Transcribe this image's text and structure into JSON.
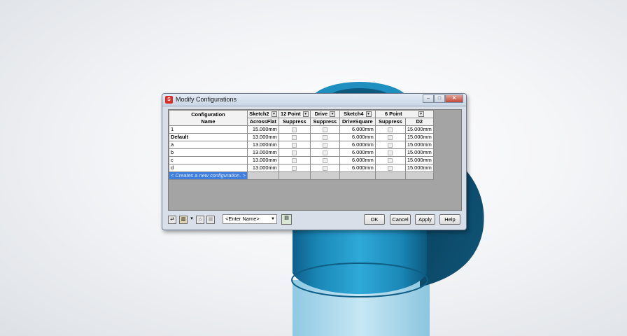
{
  "window": {
    "title": "Modify Configurations"
  },
  "table": {
    "name_header": [
      "Configuration",
      "Name"
    ],
    "feature_groups": [
      "Sketch2",
      "12 Point",
      "Drive",
      "Sketch4",
      "6 Point"
    ],
    "param_headers": [
      "AcrossFlat",
      "Suppress",
      "Suppress",
      "DriveSquare",
      "Suppress",
      "D2"
    ],
    "rows": [
      {
        "name": "1",
        "across": "15.000mm",
        "drive_sq": "6.000mm",
        "d2": "15.000mm"
      },
      {
        "name": "Default",
        "across": "13.000mm",
        "drive_sq": "6.000mm",
        "d2": "15.000mm"
      },
      {
        "name": "a",
        "across": "13.000mm",
        "drive_sq": "6.000mm",
        "d2": "15.000mm"
      },
      {
        "name": "b",
        "across": "13.000mm",
        "drive_sq": "6.000mm",
        "d2": "15.000mm"
      },
      {
        "name": "c",
        "across": "13.000mm",
        "drive_sq": "6.000mm",
        "d2": "15.000mm"
      },
      {
        "name": "d",
        "across": "13.000mm",
        "drive_sq": "6.000mm",
        "d2": "15.000mm"
      }
    ],
    "new_row": "< Creates a new configuration. >"
  },
  "bottom": {
    "name_placeholder": "<Enter Name>",
    "ok": "OK",
    "cancel": "Cancel",
    "apply": "Apply",
    "help": "Help"
  }
}
